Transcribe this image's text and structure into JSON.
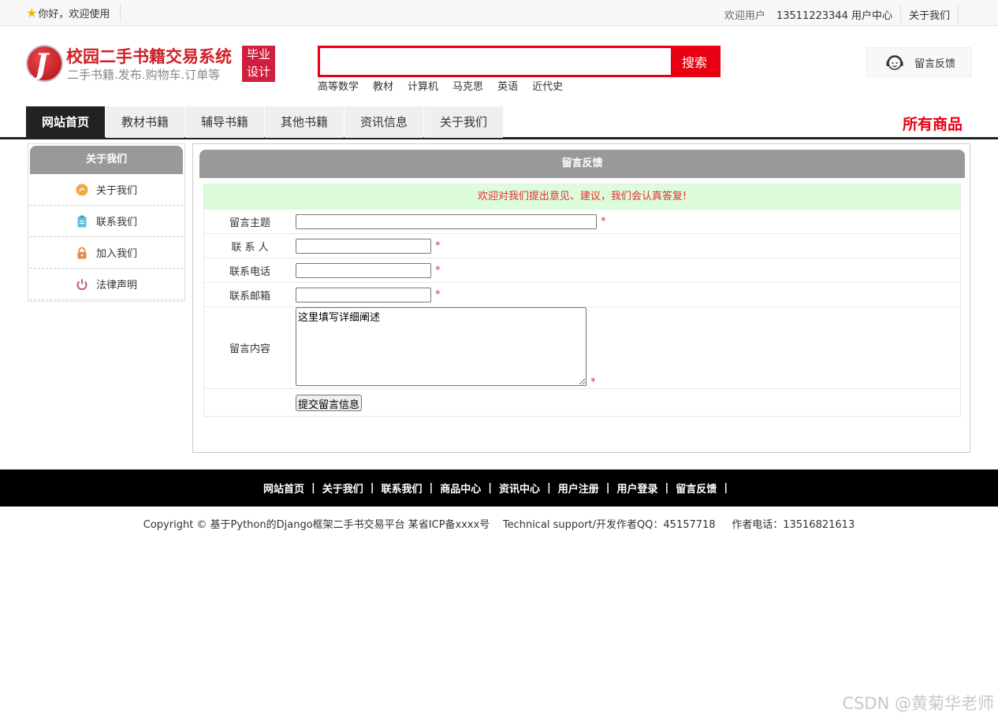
{
  "topbar": {
    "greeting": "你好，欢迎使用",
    "welcome_user": "欢迎用户",
    "phone_center": "13511223344 用户中心",
    "about": "关于我们"
  },
  "logo": {
    "title": "校园二手书籍交易系统",
    "subtitle": "二手书籍.发布.购物车.订单等",
    "badge_line1": "毕业",
    "badge_line2": "设计"
  },
  "search": {
    "value": "",
    "button": "搜索",
    "hotwords": [
      "高等数学",
      "教材",
      "计算机",
      "马克思",
      "英语",
      "近代史"
    ]
  },
  "feedback_label": "留言反馈",
  "nav": {
    "tabs": [
      "网站首页",
      "教材书籍",
      "辅导书籍",
      "其他书籍",
      "资讯信息",
      "关于我们"
    ],
    "all_goods": "所有商品"
  },
  "sidebar": {
    "title": "关于我们",
    "items": [
      {
        "label": "关于我们",
        "icon": "info-icon",
        "color": "#f5a742"
      },
      {
        "label": "联系我们",
        "icon": "clipboard-icon",
        "color": "#5bc0de"
      },
      {
        "label": "加入我们",
        "icon": "lock-icon",
        "color": "#e08c50"
      },
      {
        "label": "法律声明",
        "icon": "power-icon",
        "color": "#c06060"
      }
    ]
  },
  "main": {
    "title": "留言反馈",
    "banner": "欢迎对我们提出意见、建议，我们会认真答复!",
    "fields": {
      "subject_label": "留言主题",
      "contact_label": "联 系 人",
      "phone_label": "联系电话",
      "email_label": "联系邮箱",
      "content_label": "留言内容",
      "content_value": "这里填写详细阐述",
      "required_mark": "*"
    },
    "submit": "提交留言信息"
  },
  "footer": {
    "links": [
      "网站首页",
      "关于我们",
      "联系我们",
      "商品中心",
      "资讯中心",
      "用户注册",
      "用户登录",
      "留言反馈"
    ],
    "separator": "|",
    "copyright": "Copyright © 基于Python的Django框架二手书交易平台 某省ICP备xxxx号    Technical support/开发作者QQ：45157718     作者电话：13516821613"
  },
  "watermark": "CSDN @黄菊华老师",
  "colors": {
    "accent": "#e60012",
    "nav_active": "#222222",
    "panel_head": "#999999",
    "banner_bg": "#dcfcdc"
  }
}
